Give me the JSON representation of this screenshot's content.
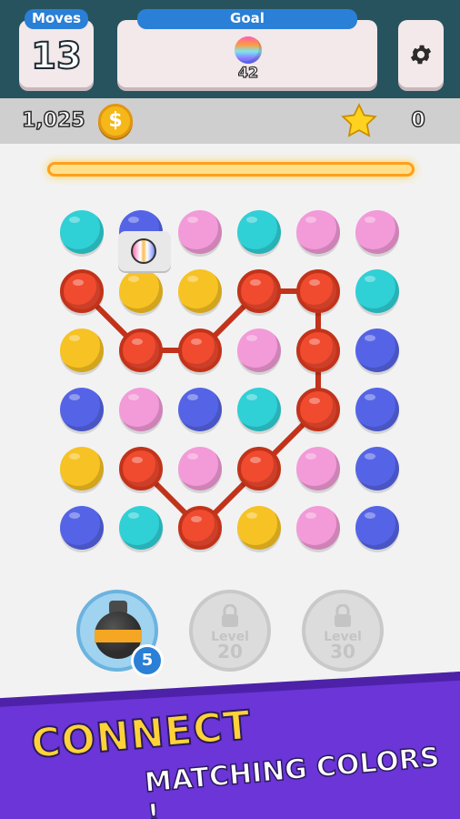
{
  "hud": {
    "moves_label": "Moves",
    "moves_value": "13",
    "goal_label": "Goal",
    "goal_value": "42",
    "coins_value": "1,025",
    "stars_value": "0"
  },
  "icons": {
    "settings": "gear-icon",
    "coin": "coin-icon",
    "star": "star-icon",
    "goal_ball": "rainbow-ball-icon",
    "bomb": "bomb-icon",
    "lock": "lock-icon"
  },
  "colors": {
    "cyan": "#2fd0d6",
    "blue": "#5564e6",
    "pink": "#f39ad8",
    "red": "#f04a2f",
    "yellow": "#f7c223"
  },
  "board": {
    "columns": 6,
    "rows": [
      [
        "cyan",
        "blue",
        "pink",
        "cyan",
        "pink",
        "pink"
      ],
      [
        "red",
        "yellow",
        "yellow",
        "red",
        "red",
        "cyan"
      ],
      [
        "yellow",
        "red",
        "red",
        "pink",
        "red",
        "blue"
      ],
      [
        "blue",
        "pink",
        "blue",
        "cyan",
        "red",
        "blue"
      ],
      [
        "yellow",
        "red",
        "pink",
        "red",
        "pink",
        "blue"
      ],
      [
        "blue",
        "cyan",
        "red",
        "yellow",
        "pink",
        "blue"
      ]
    ]
  },
  "boosters": {
    "bomb_count": "5",
    "slot2_label": "Level",
    "slot2_level": "20",
    "slot3_label": "Level",
    "slot3_level": "30"
  },
  "footer": {
    "headline": "CONNECT",
    "subline": "MATCHING COLORS !"
  }
}
